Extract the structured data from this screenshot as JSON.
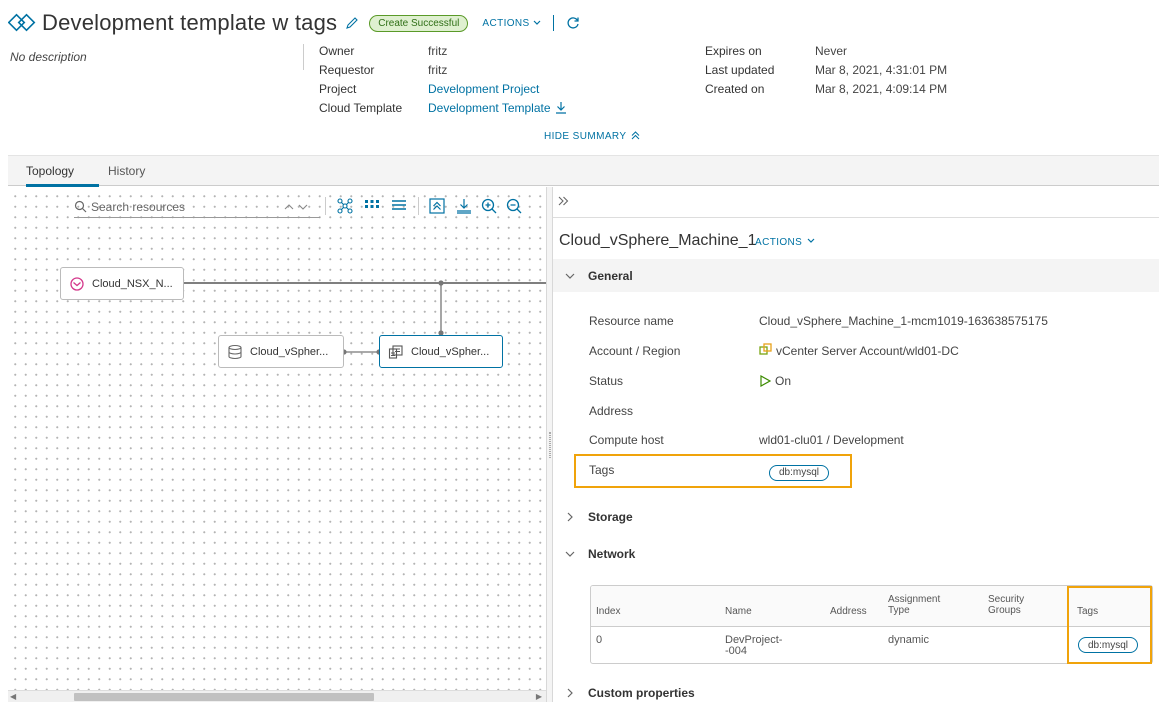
{
  "header": {
    "title": "Development template w tags",
    "status": "Create Successful",
    "actions_label": "ACTIONS",
    "description": "No description",
    "hide_summary_label": "HIDE SUMMARY"
  },
  "summary": {
    "owner_label": "Owner",
    "owner": "fritz",
    "requestor_label": "Requestor",
    "requestor": "fritz",
    "project_label": "Project",
    "project": "Development Project",
    "template_label": "Cloud Template",
    "template": "Development Template",
    "expires_label": "Expires on",
    "expires": "Never",
    "updated_label": "Last updated",
    "updated": "Mar 8, 2021, 4:31:01 PM",
    "created_label": "Created on",
    "created": "Mar 8, 2021, 4:09:14 PM"
  },
  "tabs": [
    {
      "label": "Topology",
      "active": true
    },
    {
      "label": "History",
      "active": false
    }
  ],
  "canvas": {
    "search_placeholder": "Search resources",
    "nodes": [
      {
        "label": "Cloud_NSX_N...",
        "icon": "network-icon"
      },
      {
        "label": "Cloud_vSpher...",
        "icon": "disk-icon"
      },
      {
        "label": "Cloud_vSpher...",
        "icon": "vm-icon",
        "selected": true
      }
    ]
  },
  "panel": {
    "resource_title": "Cloud_vSphere_Machine_1",
    "actions_label": "ACTIONS",
    "general": {
      "header": "General",
      "rows": [
        {
          "label": "Resource name",
          "value": "Cloud_vSphere_Machine_1-mcm1019-163638575175"
        },
        {
          "label": "Account / Region",
          "value": "vCenter Server Account/wld01-DC"
        },
        {
          "label": "Status",
          "value": "On"
        },
        {
          "label": "Address",
          "value": ""
        },
        {
          "label": "Compute host",
          "value": "wld01-clu01 / Development"
        },
        {
          "label": "Tags",
          "value": "db:mysql"
        }
      ]
    },
    "storage_header": "Storage",
    "network": {
      "header": "Network",
      "columns": [
        "Index",
        "Name",
        "Address",
        "Assignment Type",
        "Security Groups",
        "Tags"
      ],
      "rows": [
        {
          "index": "0",
          "name": "DevProject--004",
          "address": "",
          "assignment_type": "dynamic",
          "security_groups": "",
          "tags": "db:mysql"
        }
      ]
    },
    "custom_properties_header": "Custom properties"
  },
  "colors": {
    "accent": "#0072a3",
    "highlight": "#f0a30a",
    "success_bg": "#dff0d0",
    "success_border": "#5a9a28"
  }
}
